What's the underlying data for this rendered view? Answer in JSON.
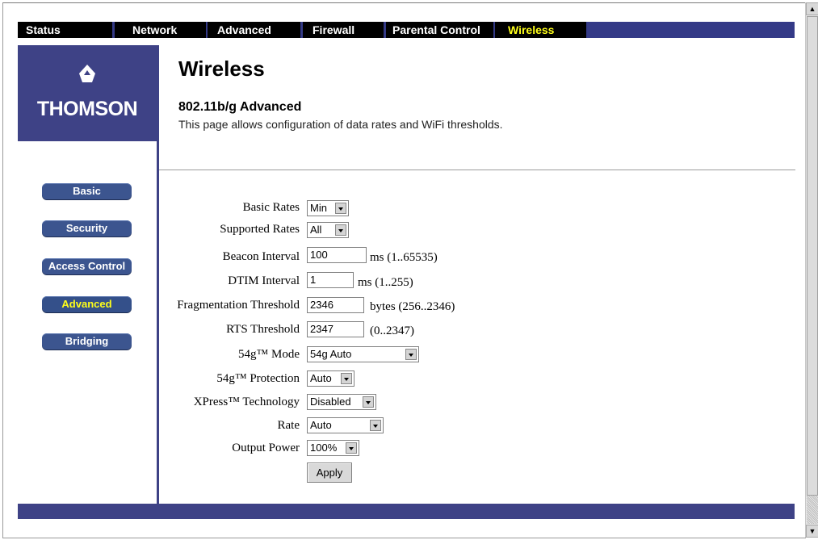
{
  "nav": {
    "tabs": [
      "Status",
      "Network",
      "Advanced",
      "Firewall",
      "Parental Control",
      "Wireless"
    ],
    "active": "Wireless"
  },
  "brand": {
    "name": "THOMSON"
  },
  "page": {
    "title": "Wireless",
    "subtitle": "802.11b/g Advanced",
    "description": "This page allows configuration of data rates and WiFi thresholds."
  },
  "sidebar": {
    "items": [
      "Basic",
      "Security",
      "Access Control",
      "Advanced",
      "Bridging"
    ],
    "active": "Advanced"
  },
  "form": {
    "basic_rates": {
      "label": "Basic Rates",
      "value": "Min"
    },
    "supported_rates": {
      "label": "Supported Rates",
      "value": "All"
    },
    "beacon_interval": {
      "label": "Beacon Interval",
      "value": "100",
      "unit": "ms (1..65535)"
    },
    "dtim_interval": {
      "label": "DTIM Interval",
      "value": "1",
      "unit": "ms (1..255)"
    },
    "fragmentation_threshold": {
      "label": "Fragmentation Threshold",
      "value": "2346",
      "unit": "bytes (256..2346)"
    },
    "rts_threshold": {
      "label": "RTS Threshold",
      "value": "2347",
      "unit": "(0..2347)"
    },
    "mode_54g": {
      "label": "54g™ Mode",
      "value": "54g Auto"
    },
    "protection_54g": {
      "label": "54g™ Protection",
      "value": "Auto"
    },
    "xpress": {
      "label": "XPress™ Technology",
      "value": "Disabled"
    },
    "rate": {
      "label": "Rate",
      "value": "Auto"
    },
    "output_power": {
      "label": "Output Power",
      "value": "100%"
    },
    "apply_label": "Apply"
  },
  "colors": {
    "brand_navy": "#3e4286",
    "nav_bar": "#343a87",
    "active_text": "#ffff1a"
  }
}
